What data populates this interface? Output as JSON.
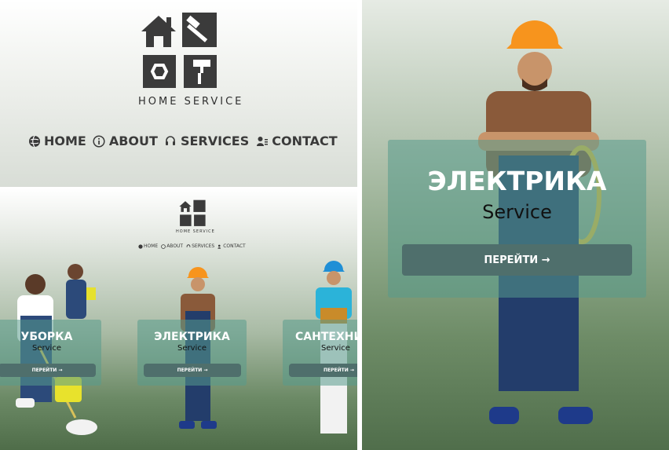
{
  "brand": {
    "caption": "HOME SERVICE"
  },
  "nav": {
    "items": [
      {
        "label": "HOME",
        "icon": "globe-icon"
      },
      {
        "label": "ABOUT",
        "icon": "info-icon"
      },
      {
        "label": "SERVICES",
        "icon": "headset-icon"
      },
      {
        "label": "CONTACT",
        "icon": "contact-card-icon"
      }
    ]
  },
  "cards": [
    {
      "title": "УБОРКА",
      "subtitle": "Service",
      "button": "ПЕРЕЙТИ →"
    },
    {
      "title": "ЭЛЕКТРИКА",
      "subtitle": "Service",
      "button": "ПЕРЕЙТИ →"
    },
    {
      "title": "САНТЕХНИ",
      "subtitle": "Service",
      "button": "ПЕРЕЙТИ →"
    }
  ],
  "detail": {
    "title": "ЭЛЕКТРИКА",
    "subtitle": "Service",
    "button": "ПЕРЕЙТИ →"
  },
  "colors": {
    "card": "#589b8c",
    "button": "#4f6f6c",
    "logo": "#3b3b3b",
    "helmet": "#f7941d"
  }
}
